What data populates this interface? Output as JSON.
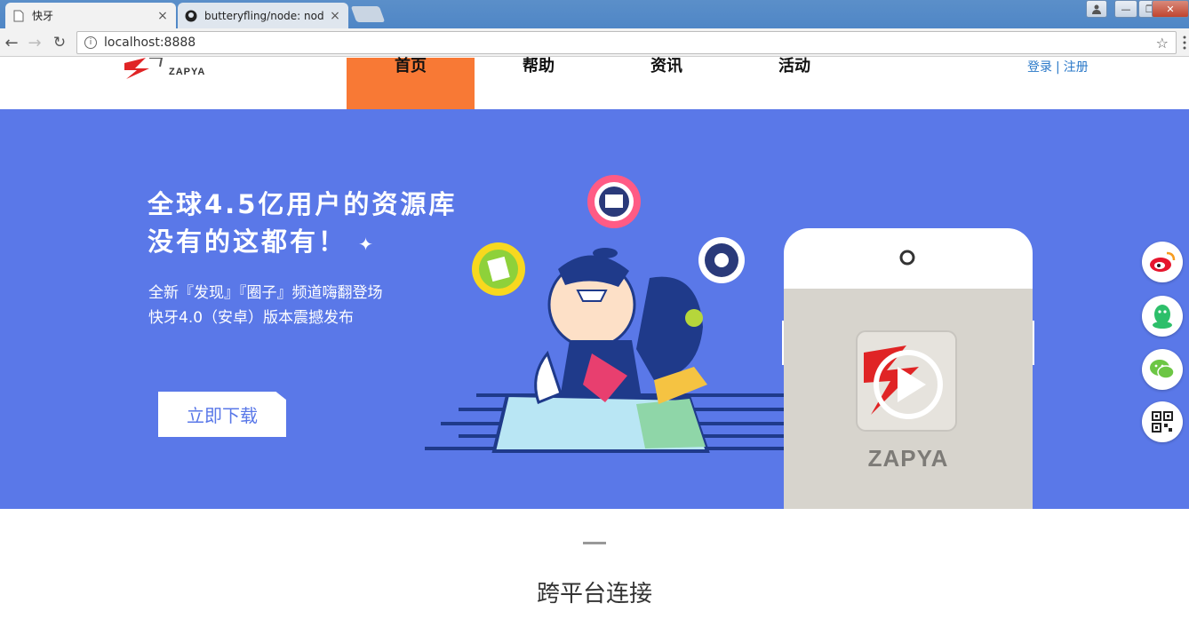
{
  "browser": {
    "tabs": [
      {
        "title": "快牙",
        "active": true
      },
      {
        "title": "butteryfling/node: nod",
        "active": false
      }
    ],
    "url": "localhost:8888"
  },
  "site": {
    "nav": [
      {
        "label": "首页",
        "active": true
      },
      {
        "label": "帮助",
        "active": false
      },
      {
        "label": "资讯",
        "active": false
      },
      {
        "label": "活动",
        "active": false
      }
    ],
    "login": "登录",
    "register": "注册",
    "logo_text": "ZAPYA"
  },
  "hero": {
    "headline_line1": "全球4.5亿用户的资源库",
    "headline_line2": "没有的这都有！",
    "sub_line1": "全新『发现』『圈子』频道嗨翻登场",
    "sub_line2": "快牙4.0（安卓）版本震撼发布",
    "download_label": "立即下载",
    "phone_brand": "ZAPYA",
    "background_color": "#5a78e8"
  },
  "section": {
    "title": "跨平台连接"
  },
  "social": [
    "weibo-icon",
    "qq-icon",
    "wechat-icon",
    "qrcode-icon"
  ],
  "colors": {
    "accent": "#f87935",
    "link": "#2a78c8"
  }
}
